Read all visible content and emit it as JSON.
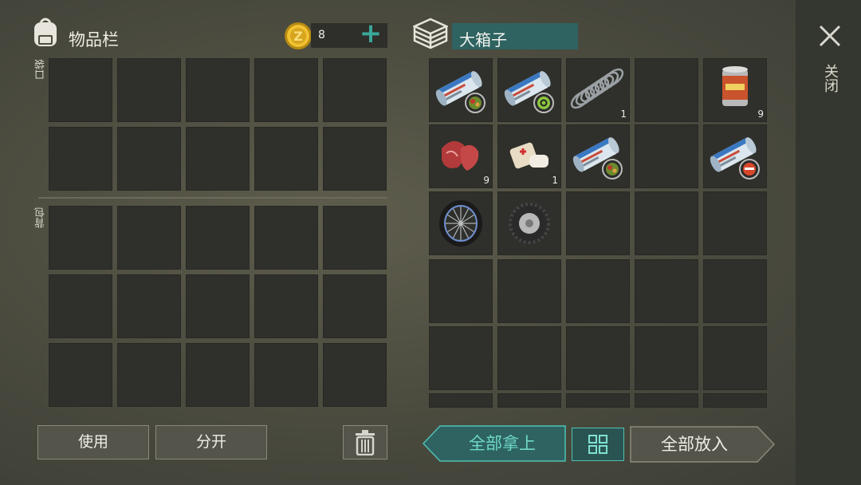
{
  "inventory": {
    "title": "物品栏",
    "coins": "8",
    "add_label": "+",
    "pocket_label": "口袋",
    "backpack_label": "背包"
  },
  "container": {
    "title": "大箱子",
    "items": [
      {
        "name": "recipe-scroll-food",
        "count": ""
      },
      {
        "name": "recipe-scroll-biohazard",
        "count": ""
      },
      {
        "name": "spring",
        "count": "1"
      },
      {
        "name": "",
        "count": ""
      },
      {
        "name": "canned-food",
        "count": "9"
      },
      {
        "name": "raw-meat",
        "count": "9"
      },
      {
        "name": "bandage",
        "count": "1"
      },
      {
        "name": "recipe-scroll-food",
        "count": ""
      },
      {
        "name": "",
        "count": ""
      },
      {
        "name": "recipe-scroll-lastday",
        "count": ""
      },
      {
        "name": "bicycle-wheel",
        "count": ""
      },
      {
        "name": "car-tire",
        "count": ""
      }
    ]
  },
  "buttons": {
    "use": "使用",
    "split": "分开",
    "take_all": "全部拿上",
    "put_all": "全部放入",
    "close": "关闭"
  },
  "icons": {
    "backpack": "backpack-icon",
    "coin": "coin-icon",
    "crate": "crate-icon",
    "trash": "trash-icon",
    "close": "close-icon",
    "sort": "sort-grid-icon"
  },
  "colors": {
    "accent_teal": "#3aa79a",
    "slot": "#2f302b",
    "title_field": "#2e6361"
  }
}
